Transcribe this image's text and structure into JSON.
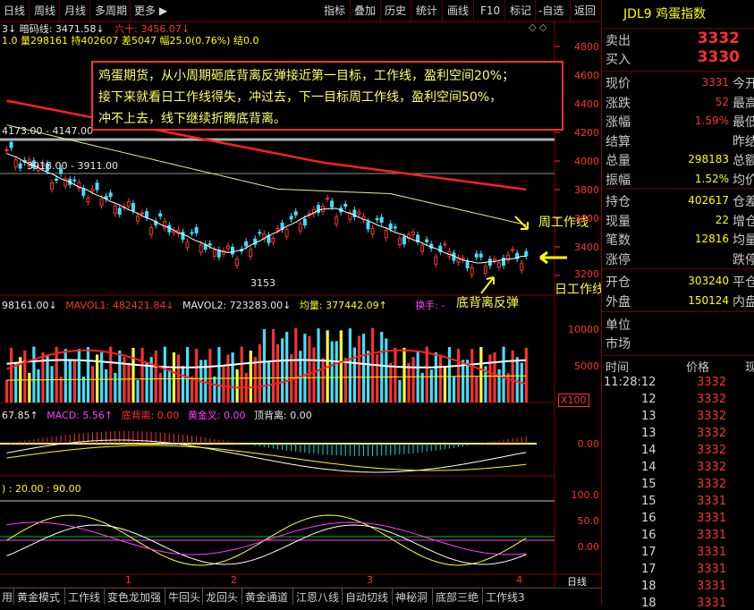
{
  "toolbar": {
    "left": [
      "日线",
      "周线",
      "月线",
      "多周期",
      "更多"
    ],
    "right": [
      "指标",
      "叠加",
      "历史",
      "统计",
      "画线",
      "F10",
      "标记",
      "-自选",
      "返回"
    ]
  },
  "info": {
    "line1_a": "3↓ 暗码线: 3471.58↓",
    "line1_b": "六十: 3456.07↓",
    "line2": "1.0 量298161 持402607 差5047 幅25.0(0.76%) 结0.0"
  },
  "annotation": {
    "line1": "鸡蛋期货，从小周期砸底背离反弹接近第一目标，工作线，盈利空间20%；",
    "line2": "接下来就看日工作线得失，冲过去，下一目标周工作线，盈利空间50%，",
    "line3": "冲不上去，线下继续折腾底背离。"
  },
  "price_labels": {
    "high": "4173.00 - 4147.00",
    "mid": "3918.00 - 3911.00",
    "low": "3153"
  },
  "chart_labels": {
    "weekly": "周工作线",
    "daily": "日工作线",
    "divergence": "底背离反弹"
  },
  "price_axis": [
    "4800",
    "4600",
    "4400",
    "4200",
    "4000",
    "3800",
    "3600",
    "3400",
    "3200"
  ],
  "volume": {
    "header_a": "98161.00↓",
    "header_b": "MAVOL1: 482421.84↓",
    "header_c": "MAVOL2: 723283.00↓",
    "header_d": "均量: 377442.09↑",
    "header_e": "换手: -",
    "axis": [
      "10000",
      "5000"
    ],
    "unit": "X100"
  },
  "macd": {
    "header_a": "67.85↑",
    "header_b": "MACD: 5.56↑",
    "header_c": "底背离: 0.00",
    "header_d": "黄金叉: 0.00",
    "header_e": "顶背离: 0.00",
    "axis": "0.00"
  },
  "kdj": {
    "header": ") : 20.00 : 90.00",
    "axis": [
      "100.0",
      "50.0",
      "0.00"
    ]
  },
  "x_labels": [
    "1",
    "2",
    "3",
    "4"
  ],
  "period_label": "日线",
  "bottom_tabs": [
    "用",
    "黄金模式",
    "工作线",
    "变色龙加强",
    "牛回头",
    "龙回头",
    "黄金通道",
    "江恩八线",
    "自动切线",
    "神秘洞",
    "底部三绝",
    "工作线3"
  ],
  "right_panel": {
    "symbol": "JDL9",
    "name": "鸡蛋指数",
    "sell_label": "卖出",
    "sell_value": "3332",
    "buy_label": "买入",
    "buy_value": "3330",
    "rows_a": [
      {
        "label": "现价",
        "value": "3331",
        "tail": "今开"
      },
      {
        "label": "涨跌",
        "value": "52",
        "tail": "最高"
      },
      {
        "label": "涨幅",
        "value": "1.59%",
        "tail": "最低"
      },
      {
        "label": "结算",
        "value": "",
        "tail": "昨结"
      },
      {
        "label": "总量",
        "value": "298183",
        "tail": "总额"
      },
      {
        "label": "振幅",
        "value": "1.52%",
        "tail": "均价"
      }
    ],
    "rows_b": [
      {
        "label": "持仓",
        "value": "402617",
        "tail": "仓差"
      },
      {
        "label": "现量",
        "value": "22",
        "tail": "增仓"
      },
      {
        "label": "笔数",
        "value": "12816",
        "tail": "均量"
      },
      {
        "label": "涨停",
        "value": "",
        "tail": "跌停"
      }
    ],
    "rows_c": [
      {
        "label": "开仓",
        "value": "303240",
        "tail": "平仓"
      },
      {
        "label": "外盘",
        "value": "150124",
        "tail": "内盘"
      }
    ],
    "rows_d": [
      "单位",
      "市场"
    ],
    "ticks_header": {
      "time": "时间",
      "price": "价格",
      "vol": "现"
    },
    "ticks": [
      {
        "t": "11:28:12",
        "p": "3332"
      },
      {
        "t": "12",
        "p": "3332"
      },
      {
        "t": "13",
        "p": "3332"
      },
      {
        "t": "13",
        "p": "3332"
      },
      {
        "t": "14",
        "p": "3332"
      },
      {
        "t": "14",
        "p": "3332"
      },
      {
        "t": "15",
        "p": "3332"
      },
      {
        "t": "15",
        "p": "3331"
      },
      {
        "t": "16",
        "p": "3331"
      },
      {
        "t": "16",
        "p": "3331"
      },
      {
        "t": "17",
        "p": "3331"
      },
      {
        "t": "17",
        "p": "3331"
      },
      {
        "t": "18",
        "p": "3331"
      },
      {
        "t": "18",
        "p": "3331"
      }
    ]
  },
  "colors": {
    "up": "#ff3030",
    "down": "#40e0ff",
    "ma": "#ffff00",
    "accent": "#ff0000"
  }
}
